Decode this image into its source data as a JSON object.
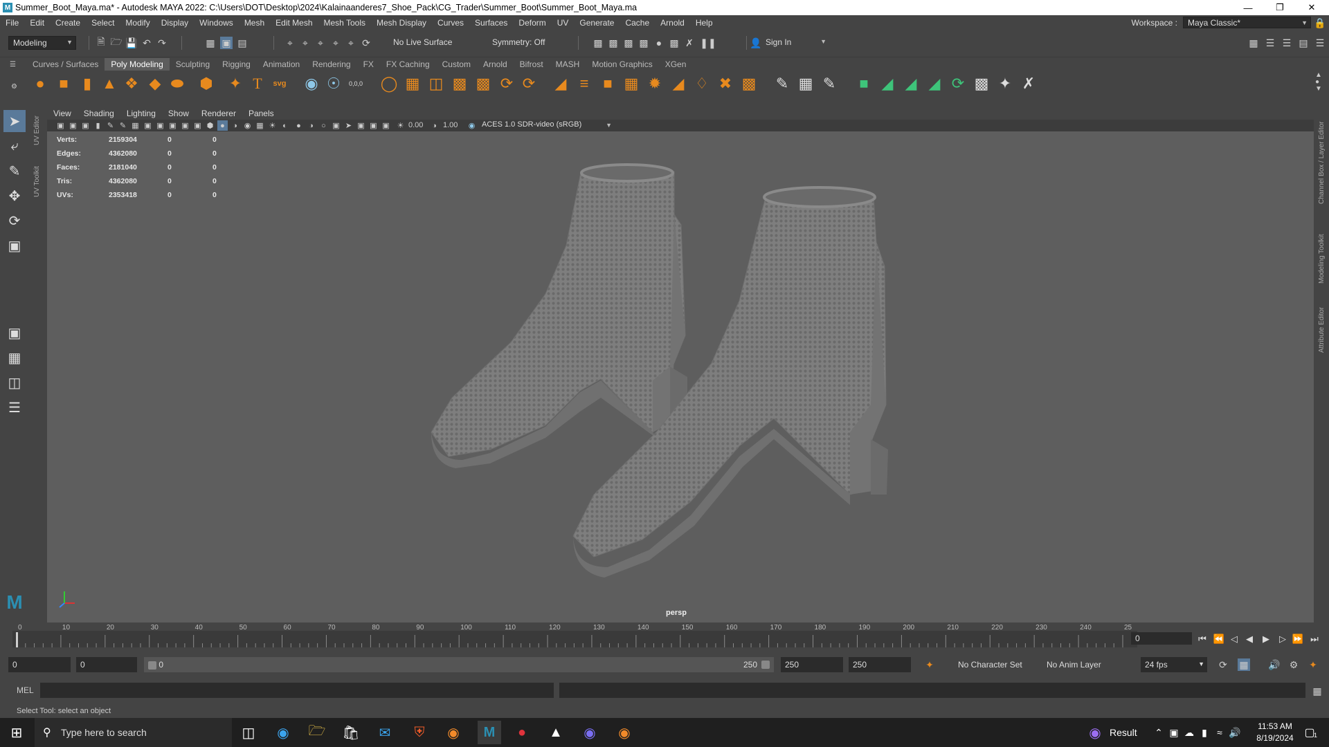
{
  "window": {
    "title": "Summer_Boot_Maya.ma* - Autodesk MAYA 2022: C:\\Users\\DOT\\Desktop\\2024\\Kalainaanderes7_Shoe_Pack\\CG_Trader\\Summer_Boot\\Summer_Boot_Maya.ma",
    "app_logo": "M"
  },
  "menu": [
    "File",
    "Edit",
    "Create",
    "Select",
    "Modify",
    "Display",
    "Windows",
    "Mesh",
    "Edit Mesh",
    "Mesh Tools",
    "Mesh Display",
    "Curves",
    "Surfaces",
    "Deform",
    "UV",
    "Generate",
    "Cache",
    "Arnold",
    "Help"
  ],
  "workspace": {
    "label": "Workspace :",
    "value": "Maya Classic*"
  },
  "toolbar": {
    "mode": "Modeling",
    "live_surface": "No Live Surface",
    "symmetry": "Symmetry: Off",
    "sign_in": "Sign In"
  },
  "shelf_tabs": [
    "Curves / Surfaces",
    "Poly Modeling",
    "Sculpting",
    "Rigging",
    "Animation",
    "Rendering",
    "FX",
    "FX Caching",
    "Custom",
    "Arnold",
    "Bifrost",
    "MASH",
    "Motion Graphics",
    "XGen"
  ],
  "active_shelf": "Poly Modeling",
  "shelf_text_icons": {
    "text_tool": "T",
    "svg_tool": "svg",
    "coord": "0,0,0"
  },
  "side_labels": {
    "uv_editor": "UV Editor",
    "uv_toolkit": "UV Toolkit",
    "channel_box": "Channel Box / Layer Editor",
    "modeling_toolkit": "Modeling Toolkit",
    "attribute_editor": "Attribute Editor"
  },
  "viewport": {
    "menu": [
      "View",
      "Shading",
      "Lighting",
      "Show",
      "Renderer",
      "Panels"
    ],
    "exposure": "0.00",
    "gamma": "1.00",
    "color_space": "ACES 1.0 SDR-video (sRGB)",
    "camera": "persp",
    "hud": [
      {
        "label": "Verts:",
        "value": "2159304",
        "sel": "0",
        "comp": "0"
      },
      {
        "label": "Edges:",
        "value": "4362080",
        "sel": "0",
        "comp": "0"
      },
      {
        "label": "Faces:",
        "value": "2181040",
        "sel": "0",
        "comp": "0"
      },
      {
        "label": "Tris:",
        "value": "4362080",
        "sel": "0",
        "comp": "0"
      },
      {
        "label": "UVs:",
        "value": "2353418",
        "sel": "0",
        "comp": "0"
      }
    ]
  },
  "timeline": {
    "ticks": [
      "0",
      "10",
      "20",
      "30",
      "40",
      "50",
      "60",
      "70",
      "80",
      "90",
      "100",
      "110",
      "120",
      "130",
      "140",
      "150",
      "160",
      "170",
      "180",
      "190",
      "200",
      "210",
      "220",
      "230",
      "240",
      "25"
    ],
    "current_frame": "0"
  },
  "range": {
    "start": "0",
    "anim_start": "0",
    "slider_start": "0",
    "slider_end": "250",
    "anim_end": "250",
    "end": "250",
    "character_set": "No Character Set",
    "anim_layer": "No Anim Layer",
    "fps": "24 fps"
  },
  "mel": {
    "label": "MEL"
  },
  "help_line": "Select Tool: select an object",
  "taskbar": {
    "search_placeholder": "Type here to search",
    "weather": "Result",
    "time": "11:53 AM",
    "date": "8/19/2024",
    "notification_count": "1"
  }
}
